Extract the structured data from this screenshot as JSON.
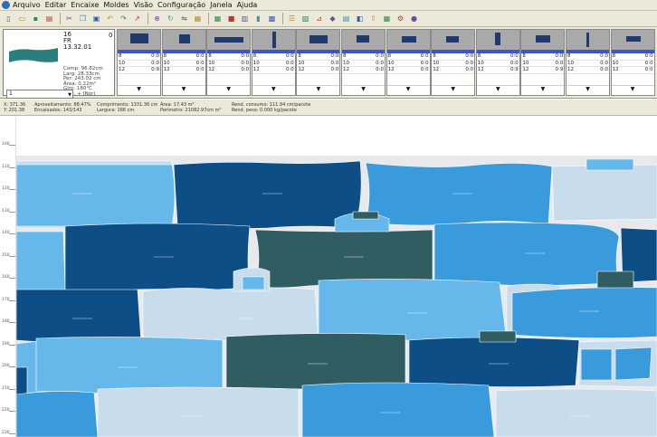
{
  "menu": {
    "items": [
      "Arquivo",
      "Editar",
      "Encaixe",
      "Moldes",
      "Visão",
      "Configuração",
      "Janela",
      "Ajuda"
    ]
  },
  "toolbar": {
    "icons": [
      "new-file-icon",
      "open-file-icon",
      "save-icon",
      "print-icon",
      "cut-icon",
      "copy-icon",
      "paste-icon",
      "undo-icon",
      "redo-icon",
      "arrow-icon",
      "zoom-icon",
      "rotate-icon",
      "mirror-icon",
      "select-icon",
      "grid-icon",
      "piece-icon",
      "fabric-icon",
      "marker-icon",
      "nest-icon",
      "align-icon",
      "spread-icon",
      "measure-icon",
      "color-icon",
      "lock-icon",
      "layer-icon",
      "export-icon",
      "report-icon",
      "settings-icon",
      "help-icon"
    ]
  },
  "current_piece": {
    "code": "16",
    "code2": "FR",
    "code3": "13.32.01",
    "count": "0",
    "info": [
      "Comp: 96.82cm",
      "Larg: 28.33cm",
      "Per: 243.02 cm",
      "Área: 0.22m²",
      "Giro: 180°C",
      "Esp.: + (Nor)"
    ],
    "size": "1"
  },
  "piece_cards": [
    {
      "shape": "block-a",
      "rows": [
        [
          "8",
          "0:0"
        ],
        [
          "10",
          "0:0"
        ],
        [
          "12",
          "0:9"
        ]
      ]
    },
    {
      "shape": "block-b",
      "rows": [
        [
          "8",
          "0:0"
        ],
        [
          "10",
          "0:0"
        ],
        [
          "12",
          "0:0"
        ]
      ]
    },
    {
      "shape": "strip-long",
      "rows": [
        [
          "8",
          "0:0"
        ],
        [
          "10",
          "0:0"
        ],
        [
          "12",
          "0:0"
        ]
      ]
    },
    {
      "shape": "strip-vertical",
      "rows": [
        [
          "8",
          "0:0"
        ],
        [
          "10",
          "0:0"
        ],
        [
          "12",
          "0:0"
        ]
      ]
    },
    {
      "shape": "block-c",
      "rows": [
        [
          "8",
          "0:0"
        ],
        [
          "10",
          "0:0"
        ],
        [
          "12",
          "0:0"
        ]
      ]
    },
    {
      "shape": "block-d",
      "rows": [
        [
          "8",
          "0:0"
        ],
        [
          "10",
          "0:0"
        ],
        [
          "12",
          "0:0"
        ]
      ]
    },
    {
      "shape": "block-e",
      "rows": [
        [
          "8",
          "0:0"
        ],
        [
          "10",
          "0:0"
        ],
        [
          "12",
          "0:0"
        ]
      ]
    },
    {
      "shape": "block-f",
      "rows": [
        [
          "8",
          "0:0"
        ],
        [
          "10",
          "0:0"
        ],
        [
          "12",
          "0:0"
        ]
      ]
    },
    {
      "shape": "block-g",
      "rows": [
        [
          "8",
          "0:0"
        ],
        [
          "10",
          "0:0"
        ],
        [
          "12",
          "0:9"
        ]
      ]
    },
    {
      "shape": "block-h",
      "rows": [
        [
          "8",
          "0:0"
        ],
        [
          "10",
          "0:0"
        ],
        [
          "12",
          "0:9"
        ]
      ]
    },
    {
      "shape": "strip-vertical-2",
      "rows": [
        [
          "8",
          "0:0"
        ],
        [
          "10",
          "0:0"
        ],
        [
          "12",
          "0:0"
        ]
      ]
    },
    {
      "shape": "block-i",
      "rows": [
        [
          "8",
          "0:0"
        ],
        [
          "10",
          "0:0"
        ],
        [
          "12",
          "0:0"
        ]
      ]
    }
  ],
  "status": {
    "cursor": [
      "X: 371.36",
      "Y: 201.38"
    ],
    "utilization": [
      "Aproveitamento: 88.47%",
      "Encaixados: 143/143"
    ],
    "length": [
      "Comprimento: 1331.36 cm",
      "Largura: 166 cm"
    ],
    "area": [
      "Área: 17.43 m²",
      "Perímetro: 21082.97cm m²"
    ],
    "yield": [
      "Rend. consumo: 111.94 cm/pacote",
      "Rend. peso: 0.000 kg/pacote"
    ]
  },
  "ruler": {
    "labels": [
      "100",
      "110",
      "120",
      "130",
      "140",
      "150",
      "160",
      "170",
      "180",
      "190",
      "200",
      "210",
      "220",
      "230",
      "240"
    ]
  },
  "colors": {
    "navy": "#0d4e87",
    "blue": "#3a9bdc",
    "sky": "#66b8ea",
    "pale": "#c9dcec",
    "slate": "#305d62",
    "gap": "#e8e9ec"
  }
}
